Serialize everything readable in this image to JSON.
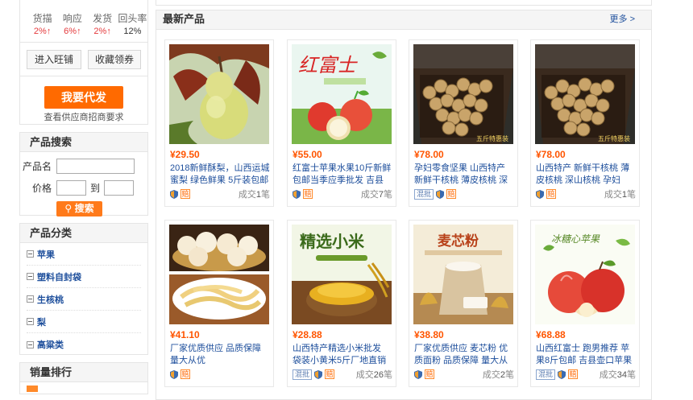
{
  "shop_stats": [
    {
      "label": "货描",
      "value": "2%↑",
      "style": "up"
    },
    {
      "label": "响应",
      "value": "6%↑",
      "style": "up"
    },
    {
      "label": "发货",
      "value": "2%↑",
      "style": "up"
    },
    {
      "label": "回头率",
      "value": "12%",
      "style": "neutral"
    }
  ],
  "shop_actions": {
    "wangpu": "进入旺铺",
    "favorite": "收藏领券"
  },
  "agent": {
    "button": "我要代发",
    "note": "查看供应商招商要求"
  },
  "search": {
    "title": "产品搜索",
    "name_label": "产品名",
    "price_label": "价格",
    "to_label": "到",
    "button": "搜索"
  },
  "categories": {
    "title": "产品分类",
    "items": [
      "苹果",
      "塑料自封袋",
      "生核桃",
      "梨",
      "高粱类"
    ]
  },
  "ranking": {
    "title": "销量排行"
  },
  "main": {
    "title": "最新产品",
    "more": "更多 >"
  },
  "labels": {
    "deal_prefix": "成交",
    "deal_suffix": "笔",
    "pi": "混批",
    "bao": "赔"
  },
  "products": [
    {
      "price": "¥29.50",
      "name": "2018新鲜酥梨，山西运城蜜梨 绿色鲜果 5斤装包邮",
      "deal": "1",
      "pi": false,
      "img": "pear"
    },
    {
      "price": "¥55.00",
      "name": "红富士苹果水果10斤新鲜包邮当季应季批发 吉县壶...",
      "deal": "7",
      "pi": false,
      "img": "apple-banner"
    },
    {
      "price": "¥78.00",
      "name": "孕妇零食坚果 山西特产 新鲜干核桃 薄皮核桃 深山...",
      "deal": "",
      "pi": true,
      "img": "walnut"
    },
    {
      "price": "¥78.00",
      "name": "山西特产 新鲜干核桃 薄皮核桃 深山核桃 孕妇零...",
      "deal": "1",
      "pi": false,
      "img": "walnut"
    },
    {
      "price": "¥41.10",
      "name": "厂家优质供应 品质保障 量大从优",
      "deal": "",
      "pi": false,
      "img": "buns"
    },
    {
      "price": "¥28.88",
      "name": "山西特产精选小米批发 袋装小黄米5斤厂地直销 月...",
      "deal": "26",
      "pi": true,
      "img": "millet"
    },
    {
      "price": "¥38.80",
      "name": "厂家优质供应 麦芯粉 优质面粉 品质保障 量大从优",
      "deal": "2",
      "pi": false,
      "img": "flour"
    },
    {
      "price": "¥68.88",
      "name": "山西红富士 跑男推荐 苹果8斤包邮 吉县壶口苹果批...",
      "deal": "34",
      "pi": true,
      "img": "apples"
    }
  ],
  "image_text": {
    "apple_banner_title": "红富士",
    "millet_title": "精选小米",
    "flour_title": "麦芯粉",
    "apples_title": "冰糖心苹果",
    "walnut_box": "五斤特惠装"
  },
  "colors": {
    "accent": "#ff6a00",
    "price": "#ff5500",
    "link": "#1e4f9c",
    "up": "#e4393c"
  }
}
